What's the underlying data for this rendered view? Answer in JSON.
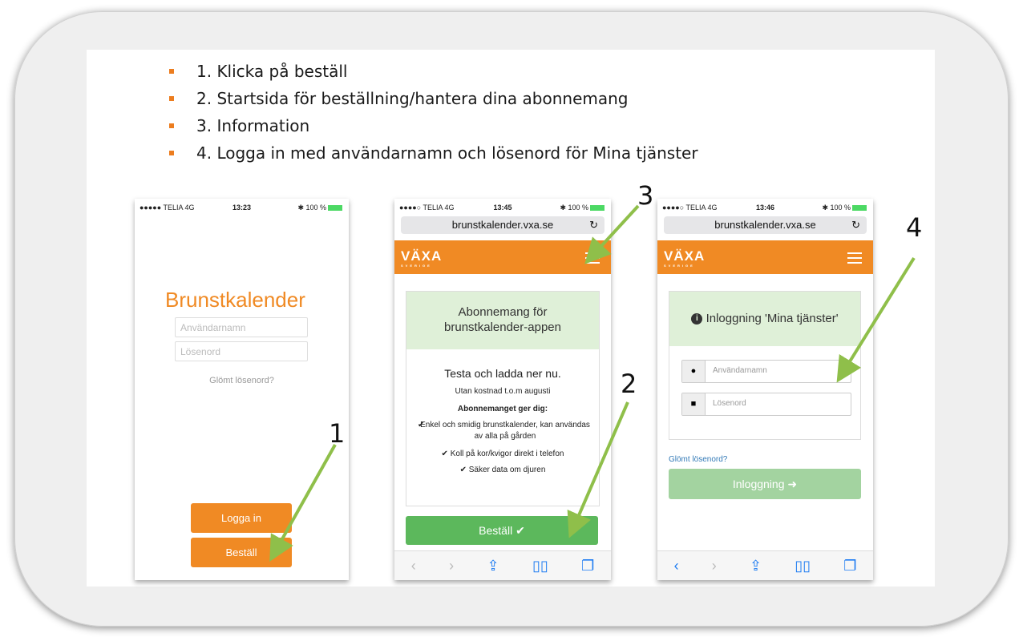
{
  "bullets": [
    "1. Klicka på beställ",
    "2. Startsida för beställning/hantera dina abonnemang",
    "3. Information",
    "4. Logga in med användarnamn och lösenord för Mina tjänster"
  ],
  "annotations": {
    "n1": "1",
    "n2": "2",
    "n3": "3",
    "n4": "4"
  },
  "colors": {
    "orange": "#f08a24",
    "green": "#5cb85c",
    "arrow": "#8fbf4a"
  },
  "phone1": {
    "carrier": "●●●●● TELIA  4G",
    "time": "13:23",
    "battery": "✱ 100 %",
    "app_title": "Brunstkalender",
    "username_placeholder": "Användarnamn",
    "password_placeholder": "Lösenord",
    "forgot": "Glömt lösenord?",
    "login_btn": "Logga in",
    "order_btn": "Beställ"
  },
  "phone2": {
    "carrier": "●●●●○ TELIA  4G",
    "time": "13:45",
    "battery": "✱ 100 %",
    "url": "brunstkalender.vxa.se",
    "logo": "VÄXA",
    "logo_sub": "SVERIGE",
    "heading": "Abonnemang för brunstkalender-appen",
    "try_title": "Testa och ladda ner nu.",
    "free_text": "Utan kostnad t.o.m augusti",
    "benefits_title": "Abonnemanget ger dig:",
    "benefits": [
      "Enkel och smidig brunstkalender, kan användas av alla på gården",
      "Koll på kor/kvigor direkt i telefon",
      "Säker data om djuren"
    ],
    "order_btn": "Beställ ✔",
    "toolbar_icons": [
      "back-icon",
      "forward-icon",
      "share-icon",
      "bookmarks-icon",
      "tabs-icon"
    ]
  },
  "phone3": {
    "carrier": "●●●●○ TELIA  4G",
    "time": "13:46",
    "battery": "✱ 100 %",
    "url": "brunstkalender.vxa.se",
    "logo": "VÄXA",
    "logo_sub": "SVERIGE",
    "login_heading": "Inloggning 'Mina tjänster'",
    "username_placeholder": "Användarnamn",
    "password_placeholder": "Lösenord",
    "forgot": "Glömt lösenord?",
    "login_btn": "Inloggning ➜"
  }
}
